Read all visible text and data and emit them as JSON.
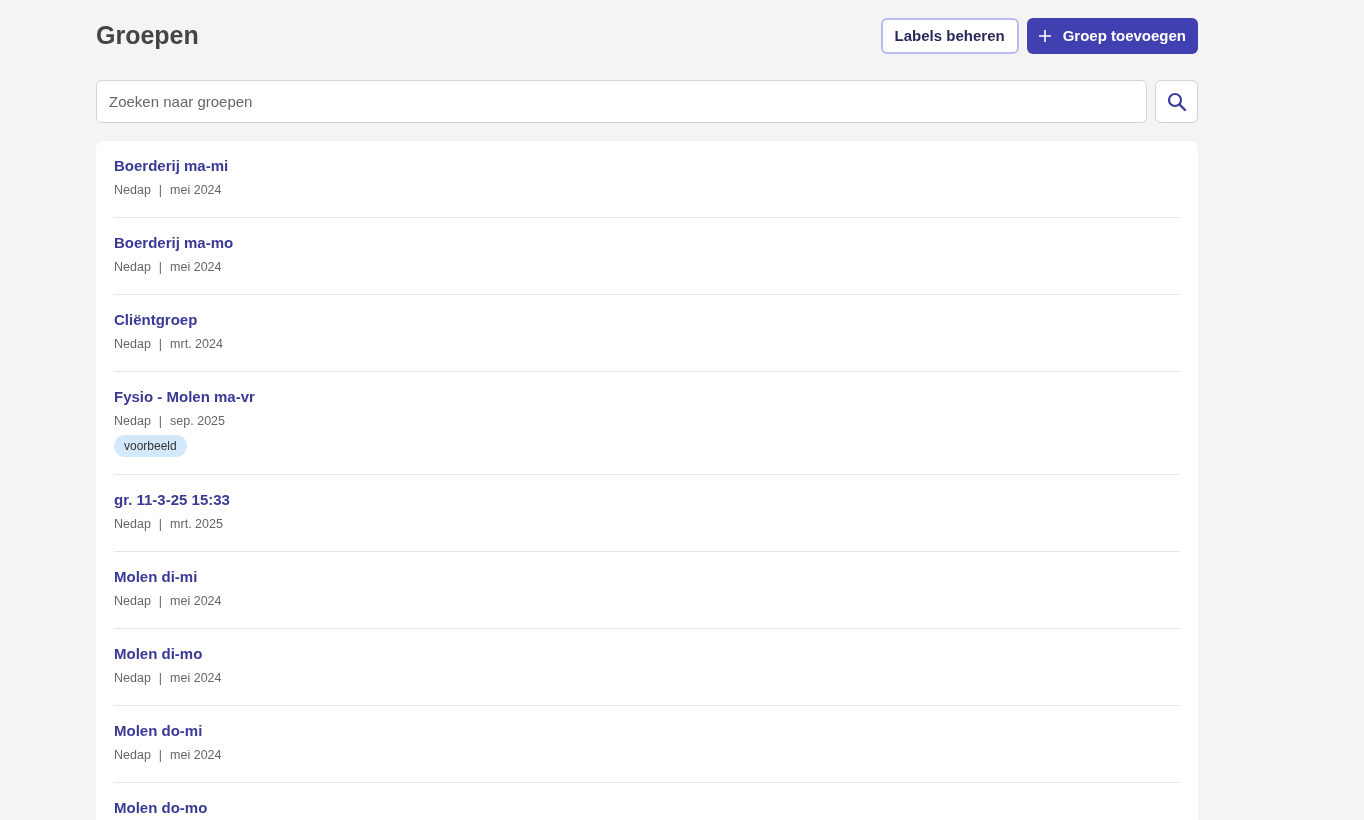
{
  "header": {
    "title": "Groepen",
    "buttons": [
      {
        "label": "Labels beheren",
        "kind": "secondary"
      },
      {
        "label": "Groep toevoegen",
        "kind": "primary"
      }
    ]
  },
  "search": {
    "placeholder": "Zoeken naar groepen"
  },
  "groups": [
    {
      "title": "Boerderij ma-mi",
      "org": "Nedap",
      "separator": "|",
      "date": "mei 2024"
    },
    {
      "title": "Boerderij ma-mo",
      "org": "Nedap",
      "separator": "|",
      "date": "mei 2024"
    },
    {
      "title": "Cliëntgroep",
      "org": "Nedap",
      "separator": "|",
      "date": "mrt. 2024"
    },
    {
      "title": "Fysio - Molen ma-vr",
      "org": "Nedap",
      "separator": "|",
      "date": "sep. 2025",
      "labels": [
        "voorbeeld"
      ]
    },
    {
      "title": "gr. 11-3-25 15:33",
      "org": "Nedap",
      "separator": "|",
      "date": "mrt. 2025"
    },
    {
      "title": "Molen di-mi",
      "org": "Nedap",
      "separator": "|",
      "date": "mei 2024"
    },
    {
      "title": "Molen di-mo",
      "org": "Nedap",
      "separator": "|",
      "date": "mei 2024"
    },
    {
      "title": "Molen do-mi",
      "org": "Nedap",
      "separator": "|",
      "date": "mei 2024"
    },
    {
      "title": "Molen do-mo"
    }
  ]
}
